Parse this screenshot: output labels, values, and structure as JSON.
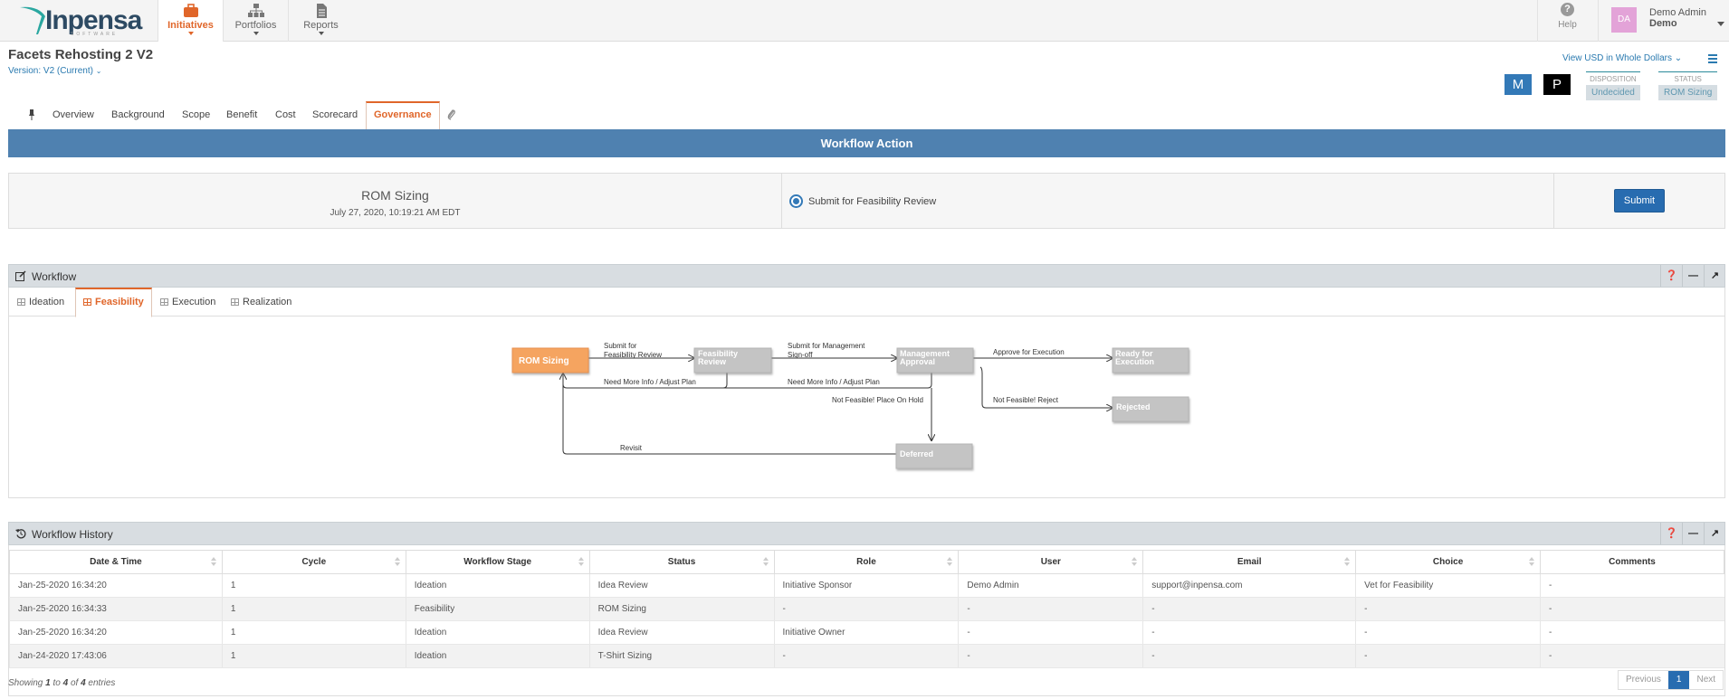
{
  "app": {
    "logo_text": "Inpensa",
    "logo_sub": "SOFTWARE",
    "nav": [
      {
        "label": "Initiatives",
        "icon": "briefcase-icon",
        "active": true
      },
      {
        "label": "Portfolios",
        "icon": "sitemap-icon",
        "active": false
      },
      {
        "label": "Reports",
        "icon": "document-icon",
        "active": false
      }
    ],
    "help_label": "Help",
    "user": {
      "initials": "DA",
      "name": "Demo Admin",
      "org": "Demo"
    }
  },
  "page": {
    "title": "Facets Rehosting 2 V2",
    "version": "Version: V2 (Current)",
    "view_currency": "View USD in Whole Dollars",
    "m_label": "M",
    "p_label": "P",
    "disposition_label": "DISPOSITION",
    "disposition_value": "Undecided",
    "status_label": "STATUS",
    "status_value": "ROM Sizing"
  },
  "tabs": [
    "Overview",
    "Background",
    "Scope",
    "Benefit",
    "Cost",
    "Scorecard",
    "Governance"
  ],
  "active_tab": "Governance",
  "workflow_action": {
    "title": "Workflow Action",
    "stage": "ROM Sizing",
    "date": "July 27, 2020, 10:19:21 AM EDT",
    "option": "Submit for Feasibility Review",
    "submit_label": "Submit"
  },
  "workflow": {
    "title": "Workflow",
    "tabs": [
      "Ideation",
      "Feasibility",
      "Execution",
      "Realization"
    ],
    "active_tab": "Feasibility",
    "nodes": [
      {
        "id": "rom",
        "label": "ROM Sizing",
        "state": "current"
      },
      {
        "id": "feas",
        "label": "Feasibility Review",
        "state": "inactive"
      },
      {
        "id": "mgmt",
        "label": "Management Approval",
        "state": "inactive"
      },
      {
        "id": "ready",
        "label": "Ready for Execution",
        "state": "inactive"
      },
      {
        "id": "rejected",
        "label": "Rejected",
        "state": "inactive"
      },
      {
        "id": "deferred",
        "label": "Deferred",
        "state": "inactive"
      }
    ],
    "edges": {
      "rom_feas": "Submit for Feasibility Review",
      "feas_mgmt": "Submit for Management Sign-off",
      "mgmt_ready": "Approve for Execution",
      "feas_rom": "Need More Info / Adjust Plan",
      "mgmt_rom": "Need More Info / Adjust Plan",
      "mgmt_deferred": "Not Feasible! Place On Hold",
      "mgmt_rejected": "Not Feasible! Reject",
      "deferred_rom": "Revisit"
    },
    "colors": {
      "current": "#f5a460",
      "inactive": "#c4c4c4"
    }
  },
  "history": {
    "title": "Workflow History",
    "columns": [
      "Date & Time",
      "Cycle",
      "Workflow Stage",
      "Status",
      "Role",
      "User",
      "Email",
      "Choice",
      "Comments"
    ],
    "rows": [
      [
        "Jan-25-2020 16:34:20",
        "1",
        "Ideation",
        "Idea Review",
        "Initiative Sponsor",
        "Demo Admin",
        "support@inpensa.com",
        "Vet for Feasibility",
        "-"
      ],
      [
        "Jan-25-2020 16:34:33",
        "1",
        "Feasibility",
        "ROM Sizing",
        "-",
        "-",
        "-",
        "-",
        "-"
      ],
      [
        "Jan-25-2020 16:34:20",
        "1",
        "Ideation",
        "Idea Review",
        "Initiative Owner",
        "-",
        "-",
        "-",
        "-"
      ],
      [
        "Jan-24-2020 17:43:06",
        "1",
        "Ideation",
        "T-Shirt Sizing",
        "-",
        "-",
        "-",
        "-",
        "-"
      ]
    ],
    "showing": {
      "prefix": "Showing",
      "from": "1",
      "to_word": "to",
      "to": "4",
      "of_word": "of",
      "total": "4",
      "suffix": "entries"
    },
    "pager": {
      "prev": "Previous",
      "current": "1",
      "next": "Next"
    }
  }
}
